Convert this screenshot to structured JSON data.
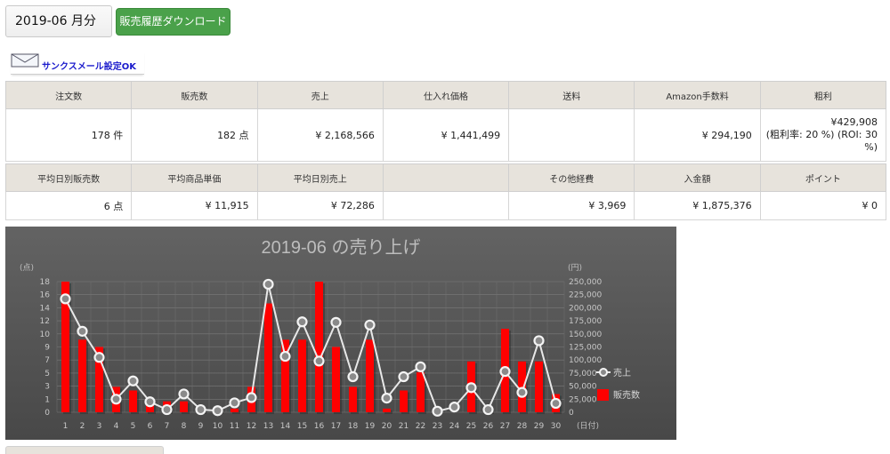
{
  "header": {
    "month_value": "2019-06 月分",
    "download_label": "販売履歴ダウンロード",
    "mail_status": "サンクスメール設定OK"
  },
  "summary": {
    "headers": [
      "注文数",
      "販売数",
      "売上",
      "仕入れ価格",
      "送料",
      "Amazon手数料",
      "粗利"
    ],
    "values": [
      "178 件",
      "182 点",
      "¥ 2,168,566",
      "¥ 1,441,499",
      "",
      "¥ 294,190"
    ],
    "gross_profit": {
      "line1": "¥429,908",
      "line2": "(粗利率: 20 %) (ROI: 30",
      "line3": "%)"
    }
  },
  "averages": {
    "headers": [
      "平均日別販売数",
      "平均商品単価",
      "平均日別売上",
      "",
      "その他経費",
      "入金額",
      "ポイント"
    ],
    "values": [
      "6 点",
      "¥ 11,915",
      "¥ 72,286",
      "",
      "¥ 3,969",
      "¥ 1,875,376",
      "¥ 0"
    ]
  },
  "colors": {
    "header_bg": "#e7e3dc",
    "download_green": "#4aa14a",
    "bar_red": "#ff0000",
    "line_white": "#e8e8e8",
    "mail_link": "#1a1acc"
  },
  "chart_data": {
    "type": "bar",
    "title": "2019-06 の売り上げ",
    "left_unit": "(点)",
    "right_unit": "(円)",
    "x_unit": "(日付)",
    "categories": [
      "1",
      "2",
      "3",
      "4",
      "5",
      "6",
      "7",
      "8",
      "9",
      "10",
      "11",
      "12",
      "13",
      "14",
      "15",
      "16",
      "17",
      "18",
      "19",
      "20",
      "21",
      "22",
      "23",
      "24",
      "25",
      "26",
      "27",
      "28",
      "29",
      "30"
    ],
    "left_ticks": [
      "0",
      "1",
      "3",
      "5",
      "7",
      "9",
      "10",
      "12",
      "14",
      "16",
      "18"
    ],
    "right_ticks": [
      "0",
      "25,000",
      "50,000",
      "75,000",
      "100,000",
      "125,000",
      "150,000",
      "175,000",
      "200,000",
      "225,000",
      "250,000"
    ],
    "ylim_left": [
      0,
      18
    ],
    "ylim_right": [
      0,
      250000
    ],
    "legend_position": "right",
    "grid": true,
    "series": [
      {
        "name": "販売数",
        "type": "bar",
        "axis": "left",
        "values": [
          18,
          10,
          9,
          3.5,
          3,
          1.5,
          1.5,
          1.5,
          0.5,
          0.5,
          0.5,
          3.5,
          15,
          10,
          10,
          18,
          9,
          3.5,
          10,
          0.5,
          3,
          5.5,
          0,
          0,
          7,
          0.2,
          11.5,
          7,
          7,
          2.5
        ]
      },
      {
        "name": "売上",
        "type": "line",
        "axis": "right",
        "values": [
          217000,
          155000,
          105000,
          25000,
          60000,
          20000,
          5000,
          35000,
          5000,
          3000,
          18000,
          28000,
          245000,
          107000,
          173000,
          98000,
          172000,
          68000,
          167000,
          27000,
          68000,
          87000,
          2000,
          10000,
          47000,
          5000,
          78000,
          38000,
          137000,
          17000
        ]
      }
    ]
  }
}
